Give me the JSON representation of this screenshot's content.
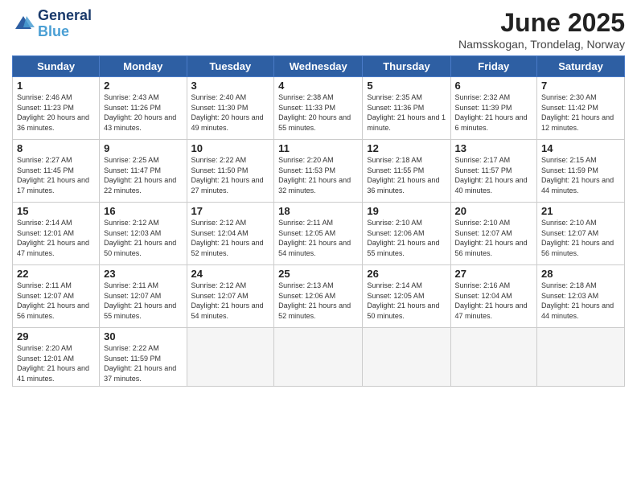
{
  "logo": {
    "line1": "General",
    "line2": "Blue"
  },
  "title": "June 2025",
  "subtitle": "Namsskogan, Trondelag, Norway",
  "days_of_week": [
    "Sunday",
    "Monday",
    "Tuesday",
    "Wednesday",
    "Thursday",
    "Friday",
    "Saturday"
  ],
  "weeks": [
    [
      {
        "day": "1",
        "sunrise": "2:46 AM",
        "sunset": "11:23 PM",
        "daylight": "20 hours and 36 minutes."
      },
      {
        "day": "2",
        "sunrise": "2:43 AM",
        "sunset": "11:26 PM",
        "daylight": "20 hours and 43 minutes."
      },
      {
        "day": "3",
        "sunrise": "2:40 AM",
        "sunset": "11:30 PM",
        "daylight": "20 hours and 49 minutes."
      },
      {
        "day": "4",
        "sunrise": "2:38 AM",
        "sunset": "11:33 PM",
        "daylight": "20 hours and 55 minutes."
      },
      {
        "day": "5",
        "sunrise": "2:35 AM",
        "sunset": "11:36 PM",
        "daylight": "21 hours and 1 minute."
      },
      {
        "day": "6",
        "sunrise": "2:32 AM",
        "sunset": "11:39 PM",
        "daylight": "21 hours and 6 minutes."
      },
      {
        "day": "7",
        "sunrise": "2:30 AM",
        "sunset": "11:42 PM",
        "daylight": "21 hours and 12 minutes."
      }
    ],
    [
      {
        "day": "8",
        "sunrise": "2:27 AM",
        "sunset": "11:45 PM",
        "daylight": "21 hours and 17 minutes."
      },
      {
        "day": "9",
        "sunrise": "2:25 AM",
        "sunset": "11:47 PM",
        "daylight": "21 hours and 22 minutes."
      },
      {
        "day": "10",
        "sunrise": "2:22 AM",
        "sunset": "11:50 PM",
        "daylight": "21 hours and 27 minutes."
      },
      {
        "day": "11",
        "sunrise": "2:20 AM",
        "sunset": "11:53 PM",
        "daylight": "21 hours and 32 minutes."
      },
      {
        "day": "12",
        "sunrise": "2:18 AM",
        "sunset": "11:55 PM",
        "daylight": "21 hours and 36 minutes."
      },
      {
        "day": "13",
        "sunrise": "2:17 AM",
        "sunset": "11:57 PM",
        "daylight": "21 hours and 40 minutes."
      },
      {
        "day": "14",
        "sunrise": "2:15 AM",
        "sunset": "11:59 PM",
        "daylight": "21 hours and 44 minutes."
      }
    ],
    [
      {
        "day": "15",
        "sunrise": "2:14 AM",
        "sunset": "12:01 AM",
        "daylight": "21 hours and 47 minutes."
      },
      {
        "day": "16",
        "sunrise": "2:12 AM",
        "sunset": "12:03 AM",
        "daylight": "21 hours and 50 minutes."
      },
      {
        "day": "17",
        "sunrise": "2:12 AM",
        "sunset": "12:04 AM",
        "daylight": "21 hours and 52 minutes."
      },
      {
        "day": "18",
        "sunrise": "2:11 AM",
        "sunset": "12:05 AM",
        "daylight": "21 hours and 54 minutes."
      },
      {
        "day": "19",
        "sunrise": "2:10 AM",
        "sunset": "12:06 AM",
        "daylight": "21 hours and 55 minutes."
      },
      {
        "day": "20",
        "sunrise": "2:10 AM",
        "sunset": "12:07 AM",
        "daylight": "21 hours and 56 minutes."
      },
      {
        "day": "21",
        "sunrise": "2:10 AM",
        "sunset": "12:07 AM",
        "daylight": "21 hours and 56 minutes."
      }
    ],
    [
      {
        "day": "22",
        "sunrise": "2:11 AM",
        "sunset": "12:07 AM",
        "daylight": "21 hours and 56 minutes."
      },
      {
        "day": "23",
        "sunrise": "2:11 AM",
        "sunset": "12:07 AM",
        "daylight": "21 hours and 55 minutes."
      },
      {
        "day": "24",
        "sunrise": "2:12 AM",
        "sunset": "12:07 AM",
        "daylight": "21 hours and 54 minutes."
      },
      {
        "day": "25",
        "sunrise": "2:13 AM",
        "sunset": "12:06 AM",
        "daylight": "21 hours and 52 minutes."
      },
      {
        "day": "26",
        "sunrise": "2:14 AM",
        "sunset": "12:05 AM",
        "daylight": "21 hours and 50 minutes."
      },
      {
        "day": "27",
        "sunrise": "2:16 AM",
        "sunset": "12:04 AM",
        "daylight": "21 hours and 47 minutes."
      },
      {
        "day": "28",
        "sunrise": "2:18 AM",
        "sunset": "12:03 AM",
        "daylight": "21 hours and 44 minutes."
      }
    ],
    [
      {
        "day": "29",
        "sunrise": "2:20 AM",
        "sunset": "12:01 AM",
        "daylight": "21 hours and 41 minutes."
      },
      {
        "day": "30",
        "sunrise": "2:22 AM",
        "sunset": "11:59 PM",
        "daylight": "21 hours and 37 minutes."
      },
      null,
      null,
      null,
      null,
      null
    ]
  ]
}
